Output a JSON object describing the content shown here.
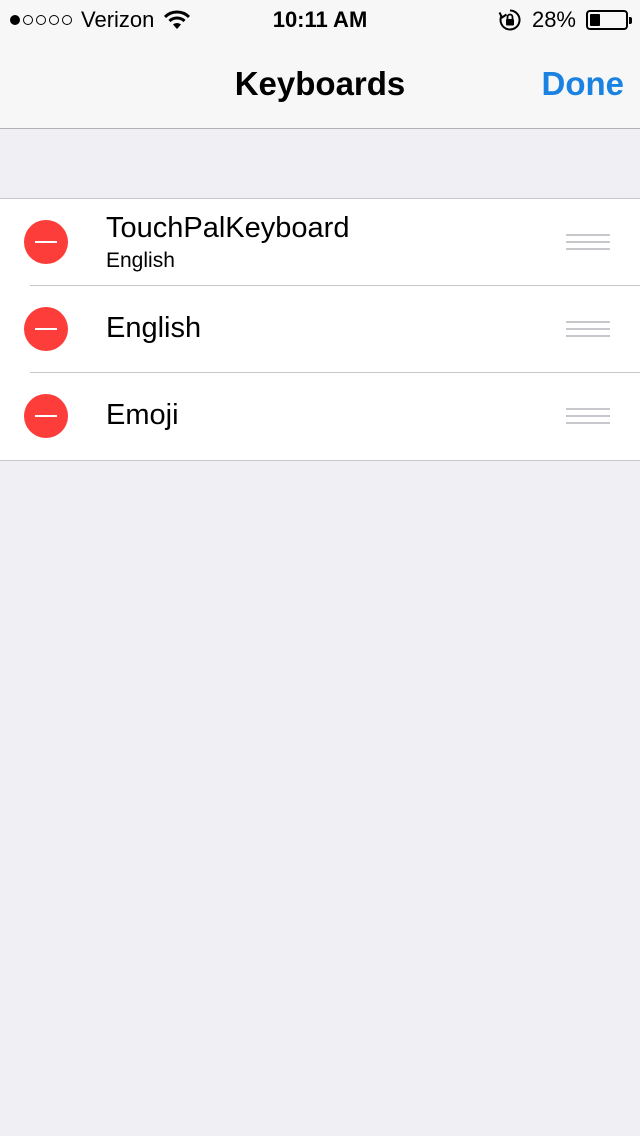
{
  "status_bar": {
    "carrier": "Verizon",
    "time": "10:11 AM",
    "battery_percent_text": "28%",
    "battery_level": 0.28,
    "signal_bars_filled": 1,
    "signal_bars_total": 5,
    "icons": [
      "signal-dots-icon",
      "wifi-icon",
      "rotation-lock-icon",
      "battery-icon"
    ]
  },
  "nav": {
    "title": "Keyboards",
    "done_label": "Done"
  },
  "keyboards": [
    {
      "name": "TouchPalKeyboard",
      "subtitle": "English"
    },
    {
      "name": "English",
      "subtitle": ""
    },
    {
      "name": "Emoji",
      "subtitle": ""
    }
  ],
  "colors": {
    "accent": "#1a82e0",
    "delete": "#fc3d39",
    "background": "#efeff4"
  }
}
